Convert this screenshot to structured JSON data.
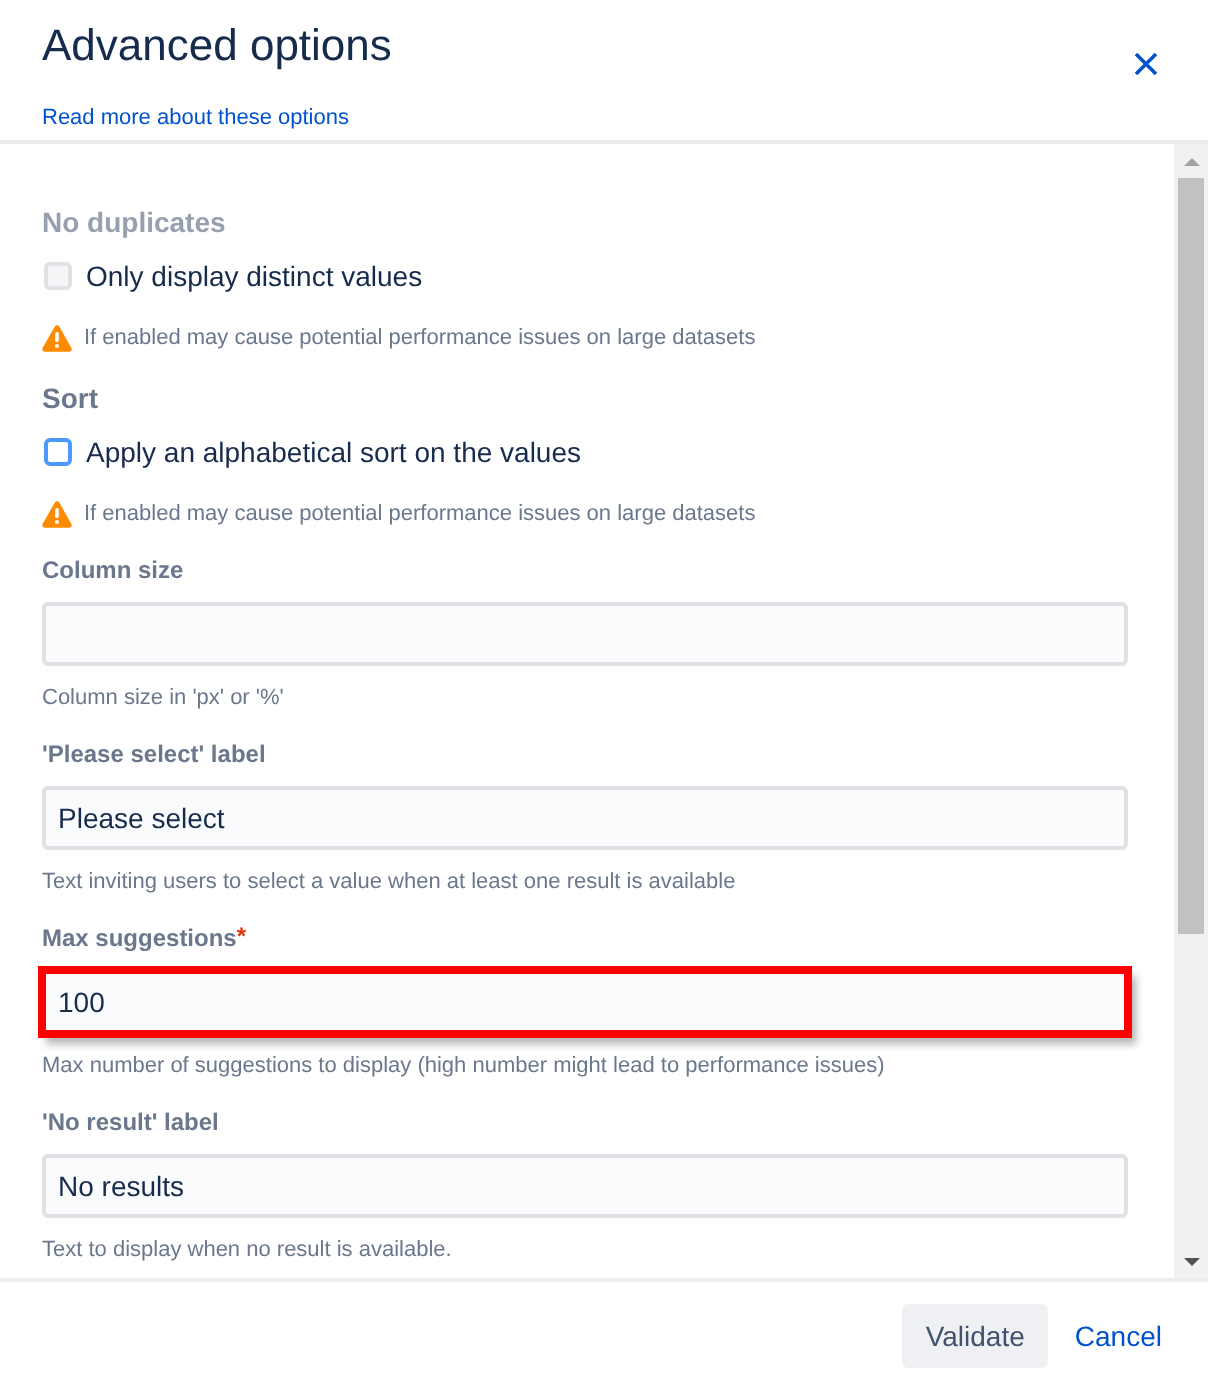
{
  "dialog": {
    "title": "Advanced options",
    "link": "Read more about these options"
  },
  "options": [
    {
      "kind": "checkbox",
      "heading": "No duplicates",
      "label": "Only display distinct values",
      "checked": false,
      "disabled": true,
      "warning": "If enabled may cause potential performance issues on large datasets"
    },
    {
      "kind": "checkbox",
      "heading": "Sort",
      "label": "Apply an alphabetical sort on the values",
      "checked": false,
      "disabled": false,
      "warning": "If enabled may cause potential performance issues on large datasets"
    },
    {
      "kind": "text",
      "label": "Column size",
      "help": "Column size in 'px' or '%'",
      "highlighted": false
    },
    {
      "kind": "text",
      "label": "'Please select' label",
      "value": "Please select",
      "help": "Text inviting users to select a value when at least one result is available",
      "highlighted": false
    },
    {
      "kind": "text",
      "label": "Max suggestions",
      "required_mark": "*",
      "value": "100",
      "help": "Max number of suggestions to display (high number might lead to performance issues)",
      "highlighted": true
    },
    {
      "kind": "text",
      "label": "'No result' label",
      "value": "No results",
      "help": "Text to display when no result is available.",
      "highlighted": false
    }
  ],
  "footer": {
    "buttons": [
      {
        "label": "Validate",
        "kind": "default"
      },
      {
        "label": "Cancel",
        "kind": "link"
      }
    ]
  }
}
